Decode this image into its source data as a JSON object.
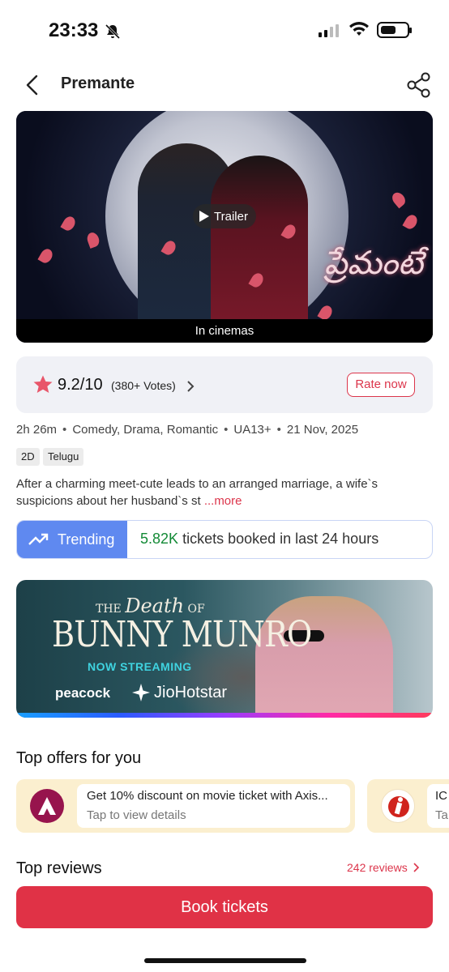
{
  "status_bar": {
    "time": "23:33"
  },
  "header": {
    "title": "Premante"
  },
  "poster": {
    "trailer_label": "Trailer",
    "banner": "In cinemas",
    "title_art": "ప్రేమంటే"
  },
  "rating": {
    "score": "9.2/10",
    "votes": "(380+ Votes)",
    "rate_label": "Rate now",
    "star_color": "#e8566a"
  },
  "meta": {
    "duration": "2h 26m",
    "genres": "Comedy, Drama, Romantic",
    "certificate": "UA13+",
    "release": "21 Nov, 2025",
    "tags": [
      "2D",
      "Telugu"
    ]
  },
  "description": {
    "text": "After a charming meet-cute leads to an arranged marriage, a wife`s suspicions about her husband`s st ",
    "more": "...more"
  },
  "trending": {
    "label": "Trending",
    "count": "5.82K",
    "text": "tickets booked in last 24 hours"
  },
  "ad": {
    "pre_title": "THE",
    "pre_title_script": "Death",
    "pre_title_of": "OF",
    "title": "BUNNY MUNRO",
    "tagline": "NOW STREAMING",
    "brand1": "peacock",
    "brand2": "JioHotstar"
  },
  "offers": {
    "title": "Top offers for you",
    "items": [
      {
        "title": "Get 10% discount on movie ticket with Axis...",
        "subtitle": "Tap to view details",
        "logo_color": "#97144d"
      },
      {
        "title": "IC",
        "subtitle": "Ta",
        "logo_color": "#d0231c"
      }
    ]
  },
  "reviews": {
    "title": "Top reviews",
    "count": "242 reviews"
  },
  "book": {
    "label": "Book tickets"
  },
  "colors": {
    "accent": "#e03246",
    "trending_blue": "#5f89f0",
    "trending_green": "#138a36"
  }
}
